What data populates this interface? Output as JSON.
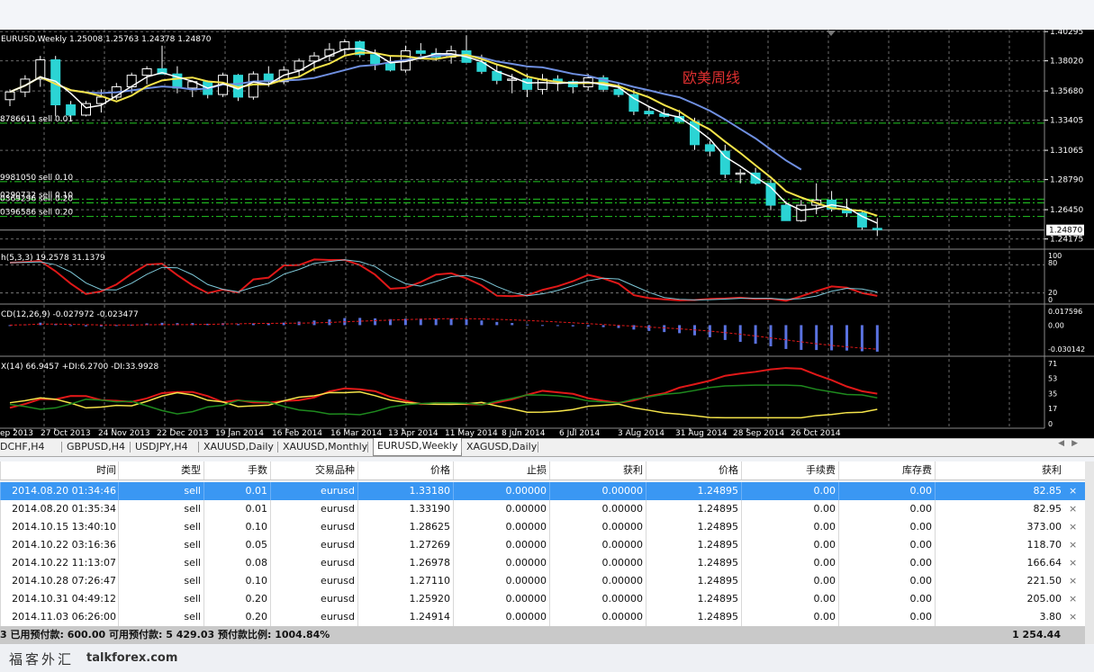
{
  "chart": {
    "title": "EURUSD,Weekly  1.25008 1.25763 1.24378 1.24870",
    "annotation": "欧美周线",
    "price_labels": [
      "1.40295",
      "1.38020",
      "1.35680",
      "1.33405",
      "1.31065",
      "1.28790",
      "1.26450",
      "1.24175"
    ],
    "current_price": "1.24870",
    "order_lines": [
      "8786611 sell 0.01",
      "9981050 sell 0.10",
      "0290732 sell 0.10",
      "0369296 sell 0.20",
      "0396586 sell 0.20"
    ],
    "stoch": {
      "label": "h(5,3,3) 19.2578 31.1379",
      "levels": [
        "100",
        "80",
        "20",
        "0"
      ]
    },
    "macd": {
      "label": "CD(12,26,9) -0.027972 -0.023477",
      "levels": [
        "0.017596",
        "0.00",
        "-0.030142"
      ]
    },
    "adx": {
      "label": "X(14) 66.9457 +DI:6.2700 -DI:33.9928",
      "levels": [
        "71",
        "53",
        "35",
        "17",
        "0"
      ]
    },
    "date_labels": [
      "ep 2013",
      "27 Oct 2013",
      "24 Nov 2013",
      "22 Dec 2013",
      "19 Jan 2014",
      "16 Feb 2014",
      "16 Mar 2014",
      "13 Apr 2014",
      "11 May 2014",
      "8 Jun 2014",
      "6 Jul 2014",
      "3 Aug 2014",
      "31 Aug 2014",
      "28 Sep 2014",
      "26 Oct 2014"
    ],
    "colors": {
      "bull": "#000000",
      "bear": "#2bd4d4",
      "fast_ma": "#ffffff",
      "slow_ma": "#f5e44a",
      "long_ma": "#6f8fe0",
      "grid": "#6a6a6a",
      "order_line": "#22c722"
    }
  },
  "chart_data": {
    "type": "candlestick",
    "series": [
      {
        "name": "EURUSD,Weekly",
        "values": [
          {
            "o": 1.35,
            "h": 1.358,
            "l": 1.345,
            "c": 1.356
          },
          {
            "o": 1.356,
            "h": 1.369,
            "l": 1.352,
            "c": 1.366
          },
          {
            "o": 1.366,
            "h": 1.384,
            "l": 1.36,
            "c": 1.381
          },
          {
            "o": 1.381,
            "h": 1.384,
            "l": 1.337,
            "c": 1.346
          },
          {
            "o": 1.346,
            "h": 1.349,
            "l": 1.334,
            "c": 1.338
          },
          {
            "o": 1.338,
            "h": 1.349,
            "l": 1.337,
            "c": 1.347
          },
          {
            "o": 1.347,
            "h": 1.358,
            "l": 1.34,
            "c": 1.352
          },
          {
            "o": 1.352,
            "h": 1.363,
            "l": 1.35,
            "c": 1.36
          },
          {
            "o": 1.36,
            "h": 1.371,
            "l": 1.355,
            "c": 1.369
          },
          {
            "o": 1.369,
            "h": 1.376,
            "l": 1.362,
            "c": 1.374
          },
          {
            "o": 1.374,
            "h": 1.392,
            "l": 1.37,
            "c": 1.37
          },
          {
            "o": 1.37,
            "h": 1.376,
            "l": 1.355,
            "c": 1.359
          },
          {
            "o": 1.359,
            "h": 1.365,
            "l": 1.352,
            "c": 1.364
          },
          {
            "o": 1.364,
            "h": 1.365,
            "l": 1.351,
            "c": 1.354
          },
          {
            "o": 1.354,
            "h": 1.371,
            "l": 1.352,
            "c": 1.369
          },
          {
            "o": 1.369,
            "h": 1.37,
            "l": 1.349,
            "c": 1.352
          },
          {
            "o": 1.352,
            "h": 1.372,
            "l": 1.35,
            "c": 1.37
          },
          {
            "o": 1.37,
            "h": 1.376,
            "l": 1.36,
            "c": 1.364
          },
          {
            "o": 1.364,
            "h": 1.376,
            "l": 1.362,
            "c": 1.373
          },
          {
            "o": 1.373,
            "h": 1.382,
            "l": 1.368,
            "c": 1.38
          },
          {
            "o": 1.38,
            "h": 1.387,
            "l": 1.372,
            "c": 1.384
          },
          {
            "o": 1.384,
            "h": 1.394,
            "l": 1.38,
            "c": 1.389
          },
          {
            "o": 1.389,
            "h": 1.397,
            "l": 1.384,
            "c": 1.395
          },
          {
            "o": 1.395,
            "h": 1.396,
            "l": 1.383,
            "c": 1.385
          },
          {
            "o": 1.385,
            "h": 1.389,
            "l": 1.373,
            "c": 1.378
          },
          {
            "o": 1.378,
            "h": 1.384,
            "l": 1.372,
            "c": 1.373
          },
          {
            "o": 1.373,
            "h": 1.392,
            "l": 1.371,
            "c": 1.388
          },
          {
            "o": 1.388,
            "h": 1.394,
            "l": 1.384,
            "c": 1.386
          },
          {
            "o": 1.386,
            "h": 1.39,
            "l": 1.38,
            "c": 1.383
          },
          {
            "o": 1.383,
            "h": 1.392,
            "l": 1.378,
            "c": 1.388
          },
          {
            "o": 1.388,
            "h": 1.4,
            "l": 1.38,
            "c": 1.379
          },
          {
            "o": 1.379,
            "h": 1.385,
            "l": 1.37,
            "c": 1.372
          },
          {
            "o": 1.372,
            "h": 1.377,
            "l": 1.362,
            "c": 1.365
          },
          {
            "o": 1.365,
            "h": 1.37,
            "l": 1.355,
            "c": 1.366
          },
          {
            "o": 1.366,
            "h": 1.37,
            "l": 1.352,
            "c": 1.358
          },
          {
            "o": 1.358,
            "h": 1.37,
            "l": 1.354,
            "c": 1.366
          },
          {
            "o": 1.366,
            "h": 1.369,
            "l": 1.357,
            "c": 1.364
          },
          {
            "o": 1.364,
            "h": 1.366,
            "l": 1.355,
            "c": 1.36
          },
          {
            "o": 1.36,
            "h": 1.37,
            "l": 1.357,
            "c": 1.367
          },
          {
            "o": 1.367,
            "h": 1.369,
            "l": 1.356,
            "c": 1.358
          },
          {
            "o": 1.358,
            "h": 1.363,
            "l": 1.352,
            "c": 1.354
          },
          {
            "o": 1.354,
            "h": 1.358,
            "l": 1.338,
            "c": 1.341
          },
          {
            "o": 1.341,
            "h": 1.345,
            "l": 1.337,
            "c": 1.339
          },
          {
            "o": 1.339,
            "h": 1.343,
            "l": 1.336,
            "c": 1.337
          },
          {
            "o": 1.337,
            "h": 1.342,
            "l": 1.332,
            "c": 1.333
          },
          {
            "o": 1.333,
            "h": 1.336,
            "l": 1.311,
            "c": 1.315
          },
          {
            "o": 1.315,
            "h": 1.318,
            "l": 1.306,
            "c": 1.31
          },
          {
            "o": 1.31,
            "h": 1.315,
            "l": 1.289,
            "c": 1.292
          },
          {
            "o": 1.292,
            "h": 1.296,
            "l": 1.285,
            "c": 1.293
          },
          {
            "o": 1.293,
            "h": 1.297,
            "l": 1.284,
            "c": 1.285
          },
          {
            "o": 1.285,
            "h": 1.288,
            "l": 1.264,
            "c": 1.268
          },
          {
            "o": 1.268,
            "h": 1.271,
            "l": 1.256,
            "c": 1.256
          },
          {
            "o": 1.256,
            "h": 1.272,
            "l": 1.255,
            "c": 1.268
          },
          {
            "o": 1.268,
            "h": 1.285,
            "l": 1.261,
            "c": 1.272
          },
          {
            "o": 1.272,
            "h": 1.279,
            "l": 1.263,
            "c": 1.265
          },
          {
            "o": 1.265,
            "h": 1.273,
            "l": 1.259,
            "c": 1.262
          },
          {
            "o": 1.262,
            "h": 1.263,
            "l": 1.249,
            "c": 1.251
          },
          {
            "o": 1.25,
            "h": 1.258,
            "l": 1.244,
            "c": 1.249
          }
        ]
      }
    ],
    "xlabel": "",
    "ylabel": "",
    "ylim": [
      1.2345,
      1.403
    ],
    "order_levels": [
      1.3318,
      1.2863,
      1.2727,
      1.2698,
      1.2592
    ],
    "stoch_range": [
      0,
      100
    ],
    "macd_range": [
      -0.030142,
      0.017596
    ],
    "adx_range": [
      0,
      71
    ]
  },
  "tabs": {
    "items": [
      "DCHF,H4",
      "GBPUSD,H4",
      "USDJPY,H4",
      "XAUUSD,Daily",
      "XAUUSD,Monthly",
      "EURUSD,Weekly",
      "XAGUSD,Daily"
    ],
    "active_index": 5
  },
  "orders": {
    "headers": [
      "时间",
      "类型",
      "手数",
      "交易品种",
      "价格",
      "止损",
      "获利",
      "价格",
      "手续费",
      "库存费",
      "获利"
    ],
    "rows": [
      [
        "2014.08.20 01:34:46",
        "sell",
        "0.01",
        "eurusd",
        "1.33180",
        "0.00000",
        "0.00000",
        "1.24895",
        "0.00",
        "0.00",
        "82.85"
      ],
      [
        "2014.08.20 01:35:34",
        "sell",
        "0.01",
        "eurusd",
        "1.33190",
        "0.00000",
        "0.00000",
        "1.24895",
        "0.00",
        "0.00",
        "82.95"
      ],
      [
        "2014.10.15 13:40:10",
        "sell",
        "0.10",
        "eurusd",
        "1.28625",
        "0.00000",
        "0.00000",
        "1.24895",
        "0.00",
        "0.00",
        "373.00"
      ],
      [
        "2014.10.22 03:16:36",
        "sell",
        "0.05",
        "eurusd",
        "1.27269",
        "0.00000",
        "0.00000",
        "1.24895",
        "0.00",
        "0.00",
        "118.70"
      ],
      [
        "2014.10.22 11:13:07",
        "sell",
        "0.08",
        "eurusd",
        "1.26978",
        "0.00000",
        "0.00000",
        "1.24895",
        "0.00",
        "0.00",
        "166.64"
      ],
      [
        "2014.10.28 07:26:47",
        "sell",
        "0.10",
        "eurusd",
        "1.27110",
        "0.00000",
        "0.00000",
        "1.24895",
        "0.00",
        "0.00",
        "221.50"
      ],
      [
        "2014.10.31 04:49:12",
        "sell",
        "0.20",
        "eurusd",
        "1.25920",
        "0.00000",
        "0.00000",
        "1.24895",
        "0.00",
        "0.00",
        "205.00"
      ],
      [
        "2014.11.03 06:26:00",
        "sell",
        "0.20",
        "eurusd",
        "1.24914",
        "0.00000",
        "0.00000",
        "1.24895",
        "0.00",
        "0.00",
        "3.80"
      ]
    ],
    "selected_index": 0,
    "summary": "3  已用预付款: 600.00  可用预付款: 5 429.03  预付款比例: 1004.84%",
    "total": "1 254.44"
  },
  "watermark": {
    "logo": "福客外汇",
    "site": "talkforex.com"
  }
}
